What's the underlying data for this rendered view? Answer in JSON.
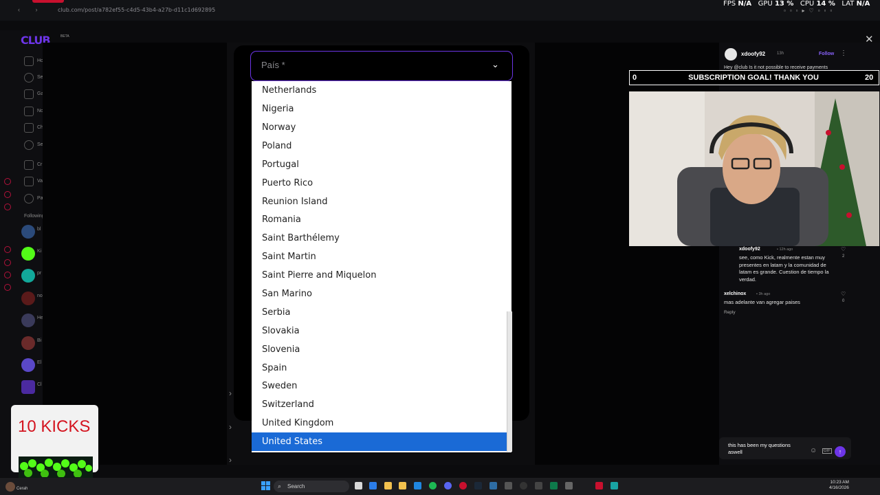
{
  "browser": {
    "url": "club.com/post/a782ef55-c4d5-43b4-a27b-d11c1d692895",
    "stats": {
      "fps_label": "FPS",
      "fps_value": "N/A",
      "gpu_label": "GPU",
      "gpu_value": "13 %",
      "cpu_label": "CPU",
      "cpu_value": "14 %",
      "lat_label": "LAT",
      "lat_value": "N/A"
    }
  },
  "app": {
    "logo": "CLUB",
    "logo_tag": "BETA",
    "sidebar_items": [
      "Ho",
      "Se",
      "Ga",
      "No",
      "Ch",
      "Se",
      "Cr",
      "Va",
      "Pa"
    ],
    "following_label": "Following",
    "following_users": [
      "bl",
      "Ki",
      "pr",
      "no",
      "He",
      "Bi",
      "El",
      "Cl"
    ]
  },
  "modal": {
    "select_placeholder": "País *",
    "options": [
      "Netherlands",
      "Nigeria",
      "Norway",
      "Poland",
      "Portugal",
      "Puerto Rico",
      "Reunion Island",
      "Romania",
      "Saint Barthélemy",
      "Saint Martin",
      "Saint Pierre and Miquelon",
      "San Marino",
      "Serbia",
      "Slovakia",
      "Slovenia",
      "Spain",
      "Sweden",
      "Switzerland",
      "United Kingdom"
    ],
    "selected_option": "United States"
  },
  "post": {
    "username": "xdoofy92",
    "time": "13h",
    "follow_label": "Follow",
    "snippet": "Hey @club Is it not possible to receive payments"
  },
  "overlay": {
    "goal_left": "0",
    "goal_title": "SUBSCRIPTION GOAL! THANK YOU",
    "goal_right": "20",
    "kicks_label": "10 KICKS"
  },
  "comments": [
    {
      "user": "xdoofy92",
      "time": "• 12h ago",
      "body": "see, como Kick, realmente estan muy presentes en latam y la comunidad de latam es grande. Cuestion de tiempo la verdad.",
      "likes": "2"
    },
    {
      "user": "xelchinox",
      "time": "• 3h ago",
      "body": "mas adelante van agregar paises",
      "likes": "0",
      "reply_label": "Reply"
    }
  ],
  "composer": {
    "text": "this has been my questions aswell"
  },
  "taskbar": {
    "search_label": "Search",
    "time": "10:23 AM",
    "date": "4/16/2026",
    "user_label": "Cerah"
  },
  "colors": {
    "accent": "#6d35e8",
    "selected": "#1a6ad6",
    "alert": "#c8102e"
  }
}
